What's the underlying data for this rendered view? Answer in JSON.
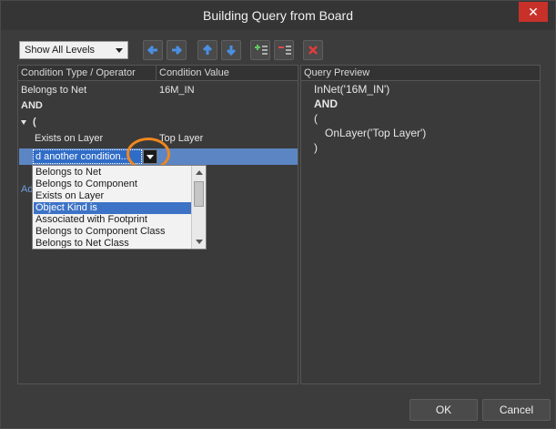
{
  "window": {
    "title": "Building Query from Board"
  },
  "toolbar": {
    "level_select": "Show All Levels"
  },
  "grid": {
    "headers": {
      "type": "Condition Type / Operator",
      "value": "Condition Value"
    },
    "rows": [
      {
        "type": "Belongs to Net",
        "value": "16M_IN"
      },
      {
        "type": "AND",
        "value": ""
      },
      {
        "type": "(",
        "value": ""
      },
      {
        "type": "Exists on Layer",
        "value": "Top Layer"
      }
    ],
    "add_row_text": "d another condition...",
    "hidden_add_label": "Ad"
  },
  "dropdown": {
    "items": [
      "Belongs to Net",
      "Belongs to Component",
      "Exists on Layer",
      "Object Kind is",
      "Associated with Footprint",
      "Belongs to Component Class",
      "Belongs to Net Class"
    ],
    "selected": "Object Kind is"
  },
  "preview": {
    "header": "Query Preview",
    "lines": [
      "InNet('16M_IN')",
      "AND",
      "(",
      "OnLayer('Top Layer')",
      ")"
    ]
  },
  "buttons": {
    "ok": "OK",
    "cancel": "Cancel"
  },
  "colors": {
    "accent": "#3d73c6",
    "highlight": "#f0861e",
    "close": "#c8312a"
  }
}
